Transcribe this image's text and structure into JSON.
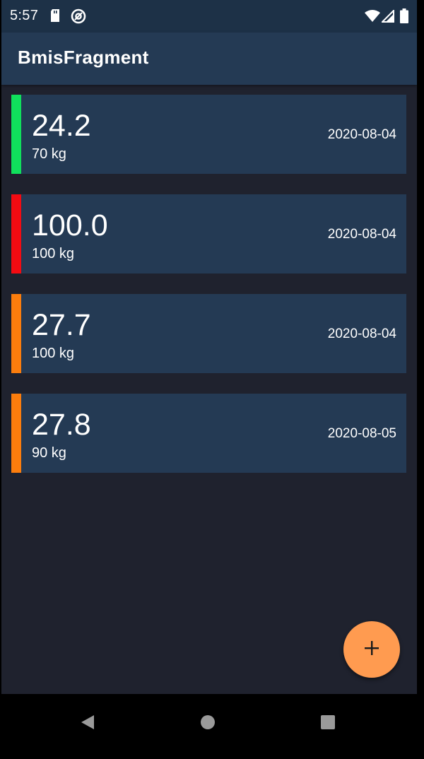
{
  "status_bar": {
    "time": "5:57",
    "icons": [
      "sd-card-icon",
      "at-sign-icon",
      "wifi-icon",
      "cell-signal-icon",
      "battery-icon"
    ]
  },
  "app_bar": {
    "title": "BmisFragment"
  },
  "bmi_entries": [
    {
      "bmi": "24.2",
      "weight": "70 kg",
      "date": "2020-08-04",
      "status_color": "#10e05c"
    },
    {
      "bmi": "100.0",
      "weight": "100 kg",
      "date": "2020-08-04",
      "status_color": "#f30b12"
    },
    {
      "bmi": "27.7",
      "weight": "100 kg",
      "date": "2020-08-04",
      "status_color": "#fb7d0d"
    },
    {
      "bmi": "27.8",
      "weight": "90 kg",
      "date": "2020-08-05",
      "status_color": "#fb7d0d"
    }
  ],
  "fab": {
    "icon": "plus-icon",
    "color": "#ff9b50"
  },
  "nav": {
    "icons": [
      "back-icon",
      "home-icon",
      "recents-icon"
    ]
  },
  "colors": {
    "background": "#1f222e",
    "app_bar": "#243a54",
    "card": "#243a54"
  }
}
